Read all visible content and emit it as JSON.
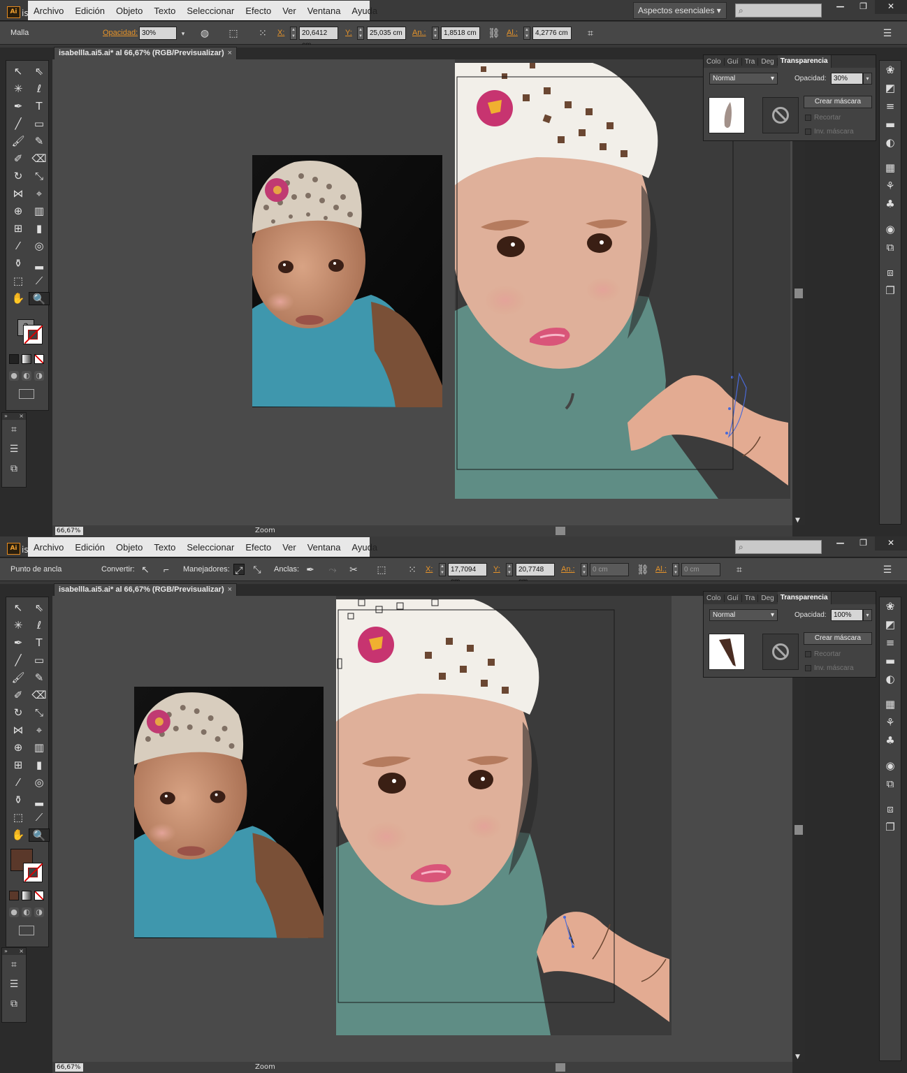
{
  "colors": {
    "accent": "#e7942a",
    "panel": "#424242",
    "canvas": "#4a4a4a",
    "fill_brown": "#5a382a"
  },
  "app": {
    "logo": "Ai",
    "title_tail": "is"
  },
  "menu": [
    "Archivo",
    "Edición",
    "Objeto",
    "Texto",
    "Seleccionar",
    "Efecto",
    "Ver",
    "Ventana",
    "Ayuda"
  ],
  "workspace": "Aspectos esenciales",
  "document": {
    "tab": "isabellla.ai5.ai* al 66,67% (RGB/Previsualizar)",
    "zoom": "66,67%",
    "status_label": "Zoom"
  },
  "shot1": {
    "ctrl": {
      "mode": "Malla",
      "opacity_label": "Opacidad:",
      "opacity": "30%",
      "x_label": "X:",
      "x": "20,6412 cm",
      "y_label": "Y:",
      "y": "25,035 cm",
      "w_label": "An.:",
      "w": "1,8518 cm",
      "h_label": "Al.:",
      "h": "4,2776 cm"
    },
    "transparency": {
      "tabs": [
        "Colo",
        "Guí",
        "Tra",
        "Deg",
        "Transparencia"
      ],
      "blend": "Normal",
      "opacity_label": "Opacidad:",
      "opacity": "30%",
      "make_mask": "Crear máscara",
      "clip": "Recortar",
      "invert": "Inv. máscara"
    },
    "fill": {
      "label": "?"
    }
  },
  "shot2": {
    "ctrl": {
      "mode": "Punto de ancla",
      "convert_label": "Convertir:",
      "handles_label": "Manejadores:",
      "anchors_label": "Anclas:",
      "x_label": "X:",
      "x": "17,7094 cm",
      "y_label": "Y:",
      "y": "20,7748 cm",
      "w_label": "An.:",
      "w": "0 cm",
      "h_label": "Al.:",
      "h": "0 cm"
    },
    "transparency": {
      "tabs": [
        "Colo",
        "Guí",
        "Tra",
        "Deg",
        "Transparencia"
      ],
      "blend": "Normal",
      "opacity_label": "Opacidad:",
      "opacity": "100%",
      "make_mask": "Crear máscara",
      "clip": "Recortar",
      "invert": "Inv. máscara"
    }
  },
  "tools": [
    "selection-tool",
    "direct-selection-tool",
    "magic-wand-tool",
    "lasso-tool",
    "pen-tool",
    "type-tool",
    "line-tool",
    "rectangle-tool",
    "paintbrush-tool",
    "pencil-tool",
    "blob-brush-tool",
    "eraser-tool",
    "rotate-tool",
    "scale-tool",
    "width-tool",
    "free-transform-tool",
    "shape-builder-tool",
    "perspective-grid-tool",
    "mesh-tool",
    "gradient-tool",
    "eyedropper-tool",
    "blend-tool",
    "symbol-sprayer-tool",
    "column-graph-tool",
    "artboard-tool",
    "slice-tool",
    "hand-tool",
    "zoom-tool"
  ]
}
